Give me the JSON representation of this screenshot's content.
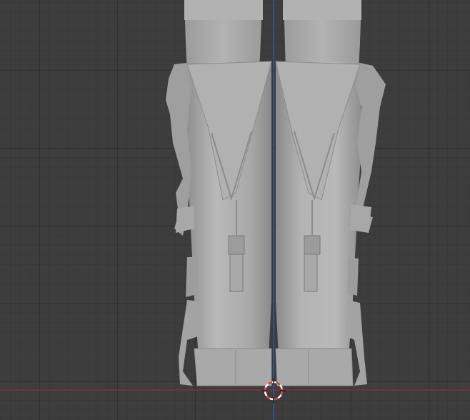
{
  "viewport": {
    "mode": "orthographic-viewport",
    "background_color": "#3d3d3d",
    "grid_major_color": "#2f2f2f",
    "grid_minor_color": "#383838"
  },
  "axes": {
    "x_axis_color": "#8a2d3a",
    "z_axis_color": "#2b5fb4"
  },
  "model": {
    "object": "boots-model",
    "base_color": "#a6a6a6",
    "shadow_color": "#7f7f7f",
    "highlight_color": "#c8c8c8"
  },
  "cursor": {
    "icon": "3d-cursor-icon",
    "primary_color": "#e23a3a",
    "secondary_color": "#ffffff"
  }
}
